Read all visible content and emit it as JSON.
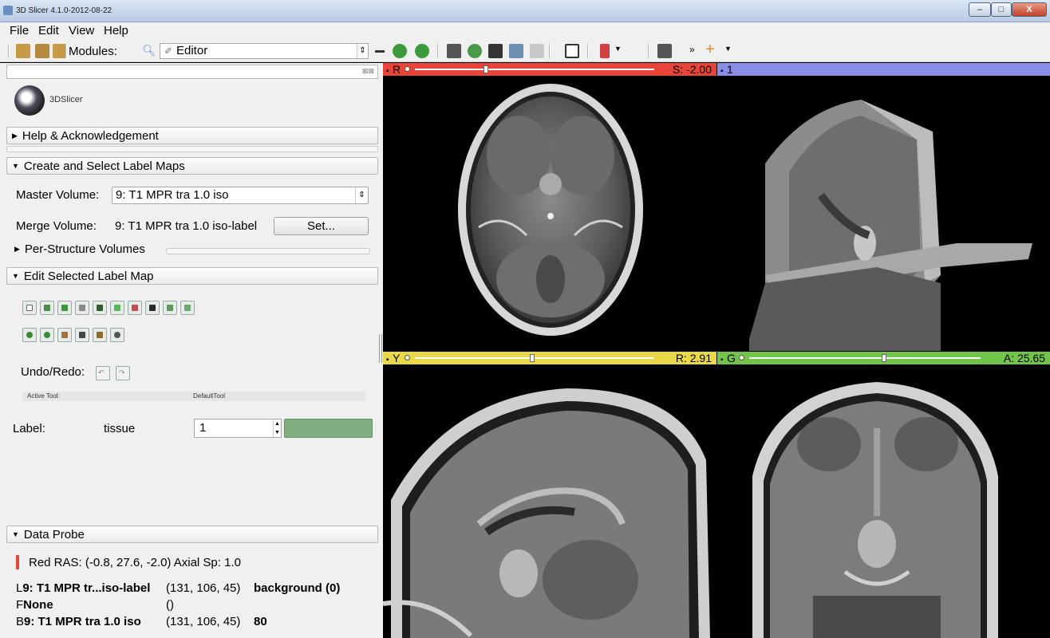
{
  "window": {
    "title": "3D Slicer 4.1.0-2012-08-22"
  },
  "menu": [
    "File",
    "Edit",
    "View",
    "Help"
  ],
  "toolbar": {
    "modules_label": "Modules:",
    "module_selected": "Editor"
  },
  "sections": {
    "help": "Help & Acknowledgement",
    "create": "Create and Select Label Maps",
    "per_structure": "Per-Structure Volumes",
    "edit": "Edit Selected Label Map",
    "probe": "Data Probe"
  },
  "logo_text": "3DSlicer",
  "master": {
    "label": "Master Volume:",
    "value": "9: T1 MPR tra 1.0 iso"
  },
  "merge": {
    "label": "Merge Volume:",
    "value": "9: T1 MPR tra 1.0 iso-label",
    "button": "Set..."
  },
  "undo_redo": "Undo/Redo:",
  "active_tool": {
    "label": "Active Tool:",
    "value": "DefaultTool"
  },
  "label": {
    "label": "Label:",
    "name": "tissue",
    "value": "1",
    "color": "#80ae80"
  },
  "probe": {
    "line1": "Red  RAS: (-0.8, 27.6, -2.0)  Axial Sp: 1.0",
    "rows": [
      {
        "prefix": "L",
        "name": "9: T1 MPR tr...iso-label",
        "ijk": "(131, 106, 45)",
        "value": "background (0)"
      },
      {
        "prefix": "F",
        "name": "None",
        "ijk": "()",
        "value": ""
      },
      {
        "prefix": "B",
        "name": "9: T1 MPR tra 1.0 iso",
        "ijk": "(131, 106, 45)",
        "value": "80"
      }
    ]
  },
  "views": {
    "red": {
      "letter": "R",
      "value": "S: -2.00",
      "color": "#e8443a"
    },
    "threed": {
      "letter": "1",
      "value": "",
      "color": "#8a8ee6"
    },
    "yellow": {
      "letter": "Y",
      "value": "R: 2.91",
      "color": "#e9d84a"
    },
    "green": {
      "letter": "G",
      "value": "A: 25.65",
      "color": "#72c54a"
    }
  },
  "window_buttons": {
    "min": "–",
    "max": "□",
    "close": "X"
  }
}
